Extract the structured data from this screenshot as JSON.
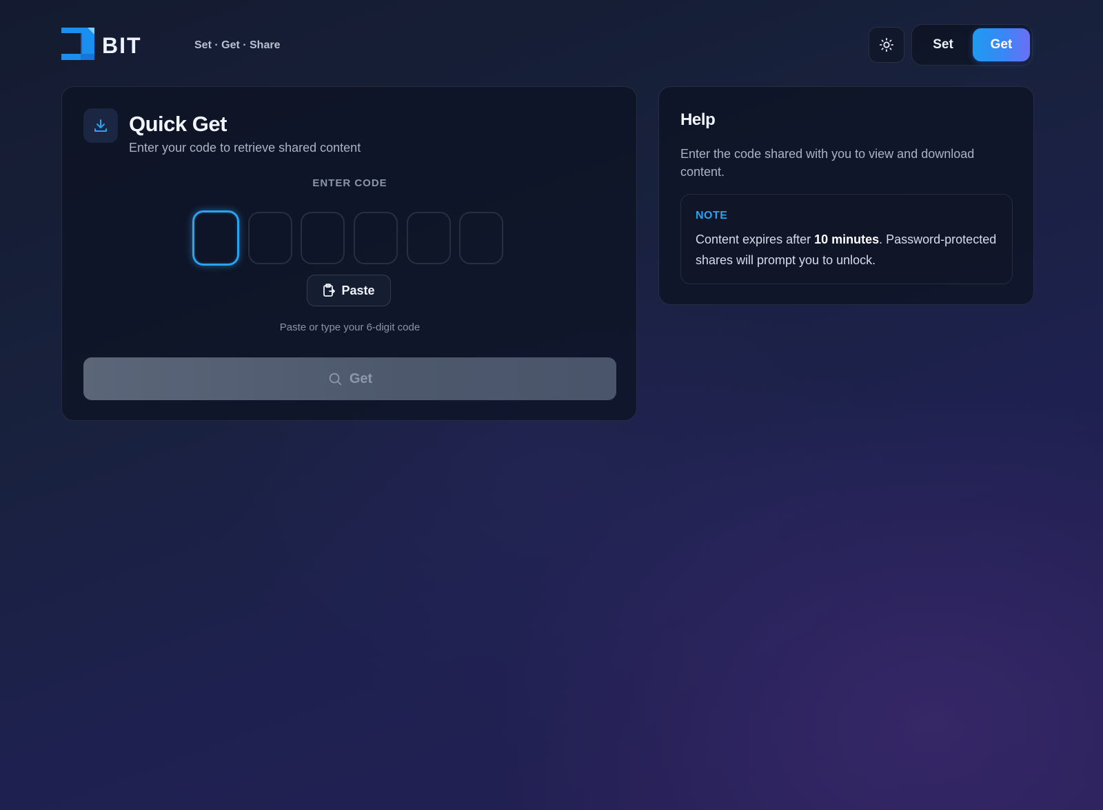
{
  "header": {
    "brand": "BIT",
    "tagline": "Set · Get · Share",
    "theme_icon": "sun-icon",
    "nav": {
      "set_label": "Set",
      "get_label": "Get",
      "active": "Get"
    }
  },
  "quick_get": {
    "icon": "download-icon",
    "title": "Quick Get",
    "subtitle": "Enter your code to retrieve shared content",
    "code_label": "ENTER CODE",
    "code_values": [
      "",
      "",
      "",
      "",
      "",
      ""
    ],
    "paste_label": "Paste",
    "paste_icon": "clipboard-icon",
    "hint": "Paste or type your 6-digit code",
    "get_label": "Get",
    "get_icon": "search-icon"
  },
  "help": {
    "title": "Help",
    "text": "Enter the code shared with you to view and download content.",
    "note_label": "NOTE",
    "note_prefix": "Content expires after ",
    "note_bold": "10 minutes",
    "note_suffix": ". Password-protected shares will prompt you to unlock."
  },
  "colors": {
    "accent": "#2aa3f0",
    "get_active_gradient_start": "#1e9cf0",
    "get_active_gradient_end": "#6a6ff5",
    "disabled_button": "#525d72"
  }
}
